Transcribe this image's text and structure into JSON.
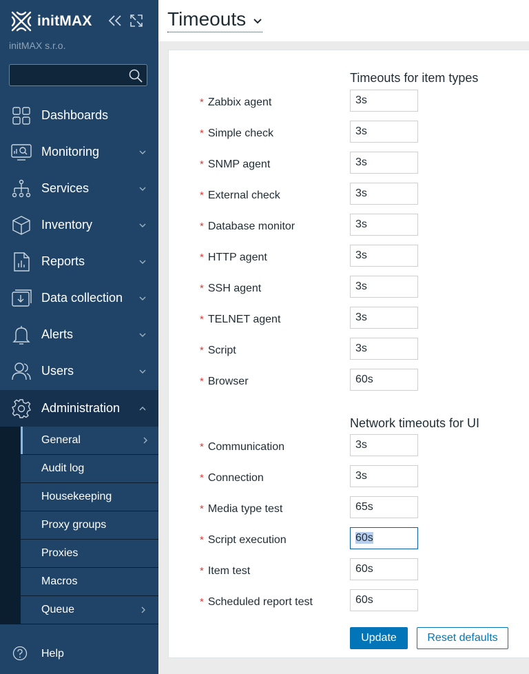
{
  "sidebar": {
    "brand": "initMAX",
    "company": "initMAX s.r.o.",
    "search_value": "",
    "nav": [
      {
        "label": "Dashboards",
        "icon": "dashboards-icon"
      },
      {
        "label": "Monitoring",
        "icon": "monitoring-icon"
      },
      {
        "label": "Services",
        "icon": "services-icon"
      },
      {
        "label": "Inventory",
        "icon": "inventory-icon"
      },
      {
        "label": "Reports",
        "icon": "reports-icon"
      },
      {
        "label": "Data collection",
        "icon": "data-collection-icon"
      },
      {
        "label": "Alerts",
        "icon": "alerts-icon"
      },
      {
        "label": "Users",
        "icon": "users-icon"
      },
      {
        "label": "Administration",
        "icon": "administration-icon"
      }
    ],
    "submenu": [
      {
        "label": "General"
      },
      {
        "label": "Audit log"
      },
      {
        "label": "Housekeeping"
      },
      {
        "label": "Proxy groups"
      },
      {
        "label": "Proxies"
      },
      {
        "label": "Macros"
      },
      {
        "label": "Queue"
      }
    ],
    "help": "Help"
  },
  "header": {
    "title": "Timeouts"
  },
  "form": {
    "section_items": "Timeouts for item types",
    "item_types": [
      {
        "label": "Zabbix agent",
        "value": "3s"
      },
      {
        "label": "Simple check",
        "value": "3s"
      },
      {
        "label": "SNMP agent",
        "value": "3s"
      },
      {
        "label": "External check",
        "value": "3s"
      },
      {
        "label": "Database monitor",
        "value": "3s"
      },
      {
        "label": "HTTP agent",
        "value": "3s"
      },
      {
        "label": "SSH agent",
        "value": "3s"
      },
      {
        "label": "TELNET agent",
        "value": "3s"
      },
      {
        "label": "Script",
        "value": "3s"
      },
      {
        "label": "Browser",
        "value": "60s"
      }
    ],
    "section_network": "Network timeouts for UI",
    "network": [
      {
        "label": "Communication",
        "value": "3s"
      },
      {
        "label": "Connection",
        "value": "3s"
      },
      {
        "label": "Media type test",
        "value": "65s"
      },
      {
        "label": "Script execution",
        "value": "60s"
      },
      {
        "label": "Item test",
        "value": "60s"
      },
      {
        "label": "Scheduled report test",
        "value": "60s"
      }
    ],
    "update_label": "Update",
    "reset_label": "Reset defaults"
  },
  "colors": {
    "sidebar_bg": "#1f4468",
    "sidebar_dark": "#0b1e30",
    "accent": "#0275b8",
    "required": "#e33734"
  }
}
